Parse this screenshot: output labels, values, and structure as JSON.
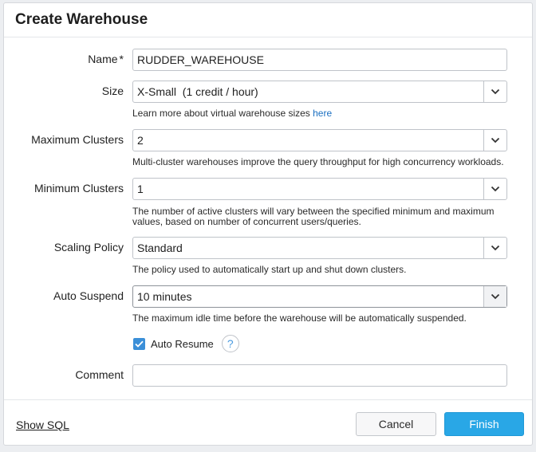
{
  "dialog": {
    "title": "Create Warehouse"
  },
  "form": {
    "name": {
      "label": "Name",
      "required_mark": "*",
      "value": "RUDDER_WAREHOUSE"
    },
    "size": {
      "label": "Size",
      "value": "X-Small  (1 credit / hour)",
      "help_text": "Learn more about virtual warehouse sizes ",
      "help_link": "here"
    },
    "max_clusters": {
      "label": "Maximum Clusters",
      "value": "2",
      "help_text": "Multi-cluster warehouses improve the query throughput for high concurrency workloads."
    },
    "min_clusters": {
      "label": "Minimum Clusters",
      "value": "1",
      "help_text": "The number of active clusters will vary between the specified minimum and maximum values, based on number of concurrent users/queries."
    },
    "scaling_policy": {
      "label": "Scaling Policy",
      "value": "Standard",
      "help_text": "The policy used to automatically start up and shut down clusters."
    },
    "auto_suspend": {
      "label": "Auto Suspend",
      "value": "10 minutes",
      "help_text": "The maximum idle time before the warehouse will be automatically suspended."
    },
    "auto_resume": {
      "label": "Auto Resume",
      "checked": true,
      "help_icon": "?"
    },
    "comment": {
      "label": "Comment",
      "value": ""
    }
  },
  "footer": {
    "show_sql": "Show SQL",
    "cancel": "Cancel",
    "finish": "Finish"
  },
  "colors": {
    "accent": "#29a7e6",
    "link": "#1a6fc1",
    "checkbox": "#3b8fd8"
  }
}
